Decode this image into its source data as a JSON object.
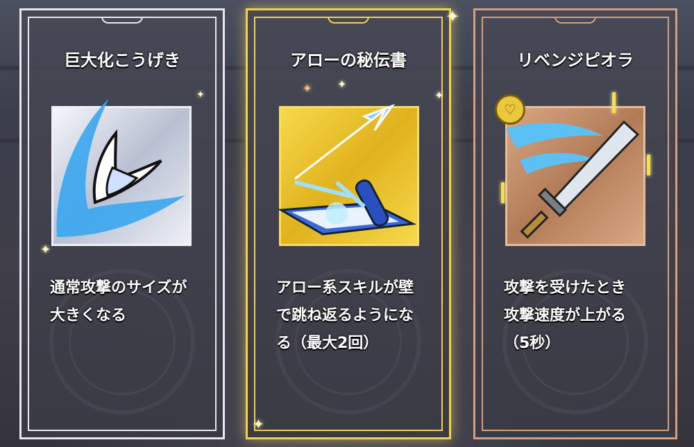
{
  "cards": [
    {
      "title": "巨大化こうげき",
      "icon": "giant-slash-icon",
      "desc": [
        "通常攻撃のサイズが",
        "大きくなる"
      ],
      "frame_color": "#e8e8ee"
    },
    {
      "title": "アローの秘伝書",
      "icon": "arrow-scroll-icon",
      "desc": [
        "アロー系スキルが壁",
        "で跳ね返るようにな",
        "る（最大2回）"
      ],
      "frame_color": "#f2d24a"
    },
    {
      "title": "リベンジピオラ",
      "icon": "revenge-sword-icon",
      "desc": [
        "攻撃を受けたとき",
        "攻撃速度が上がる",
        "（5秒）"
      ],
      "frame_color": "#d6a07a"
    }
  ]
}
